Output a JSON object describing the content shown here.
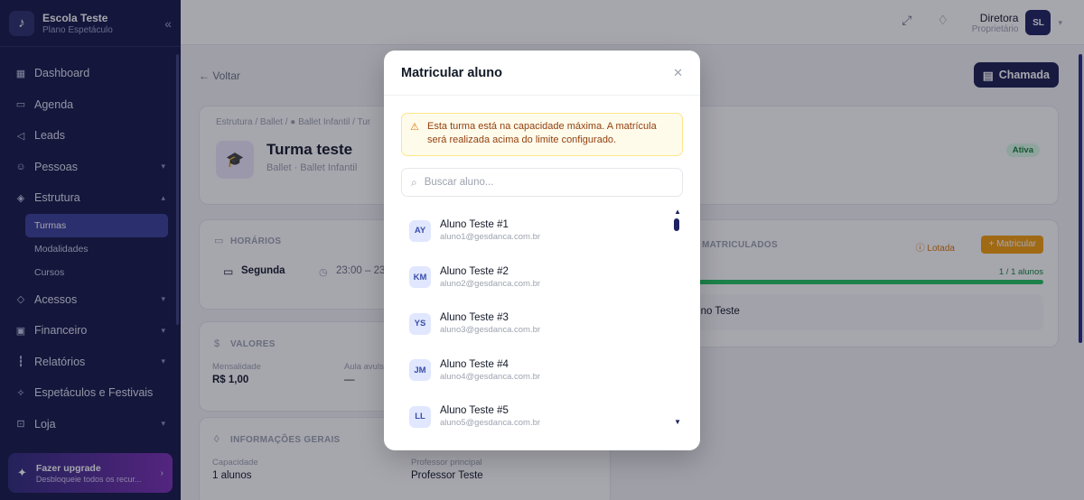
{
  "brand": {
    "name": "Escola Teste",
    "plan": "Plano Espetáculo"
  },
  "nav": {
    "items": [
      {
        "label": "Dashboard",
        "icon": "grid-icon"
      },
      {
        "label": "Agenda",
        "icon": "calendar-icon"
      },
      {
        "label": "Leads",
        "icon": "megaphone-icon"
      },
      {
        "label": "Pessoas",
        "icon": "users-icon"
      },
      {
        "label": "Estrutura",
        "icon": "layers-icon"
      }
    ],
    "sub_items": [
      "Turmas",
      "Modalidades",
      "Cursos"
    ],
    "items_after": [
      {
        "label": "Acessos",
        "icon": "shield-icon"
      },
      {
        "label": "Financeiro",
        "icon": "wallet-icon"
      },
      {
        "label": "Relatórios",
        "icon": "bar-chart-icon"
      },
      {
        "label": "Espetáculos e Festivais",
        "icon": "sparkle-icon"
      },
      {
        "label": "Loja",
        "icon": "bag-icon"
      }
    ]
  },
  "upgrade": {
    "title": "Fazer upgrade",
    "desc": "Desbloqueie todos os recur..."
  },
  "user": {
    "role": "Diretora",
    "sub": "Proprietário",
    "initials": "SL"
  },
  "page": {
    "back": "Voltar",
    "chamada": "Chamada",
    "crumbs": "Estrutura / Ballet / ● Ballet Infantil / Tur",
    "title": "Turma teste",
    "subtitle": "Ballet · Ballet Infantil",
    "status": "Ativa",
    "horarios_title": "HORÁRIOS",
    "horario_day": "Segunda",
    "horario_time": "23:00 – 23",
    "valores_title": "VALORES",
    "mensalidade_label": "Mensalidade",
    "mensalidade_value": "R$ 1,00",
    "aula_label": "Aula avulsa",
    "aula_value": "—",
    "info_title": "INFORMAÇÕES GERAIS",
    "capacidade_label": "Capacidade",
    "capacidade_value": "1 alunos",
    "professor_label": "Professor principal",
    "professor_value": "Professor Teste",
    "matriculados_title": "MATRICULADOS",
    "lotada": "Lotada",
    "matricular": "Matricular",
    "progress_text": "1 / 1 alunos",
    "progress": 1.0,
    "enrolled_student": "Aluno Teste"
  },
  "modal": {
    "title": "Matricular aluno",
    "warning": "Esta turma está na capacidade máxima. A matrícula será realizada acima do limite configurado.",
    "search_placeholder": "Buscar aluno...",
    "students": [
      {
        "initials": "AY",
        "name": "Aluno Teste #1",
        "email": "aluno1@gesdanca.com.br"
      },
      {
        "initials": "KM",
        "name": "Aluno Teste #2",
        "email": "aluno2@gesdanca.com.br"
      },
      {
        "initials": "YS",
        "name": "Aluno Teste #3",
        "email": "aluno3@gesdanca.com.br"
      },
      {
        "initials": "JM",
        "name": "Aluno Teste #4",
        "email": "aluno4@gesdanca.com.br"
      },
      {
        "initials": "LL",
        "name": "Aluno Teste #5",
        "email": "aluno5@gesdanca.com.br"
      }
    ]
  }
}
